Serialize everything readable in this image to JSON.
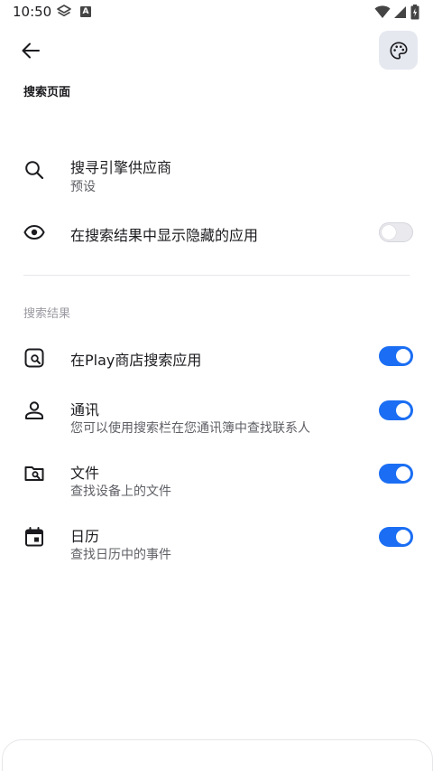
{
  "status_bar": {
    "time": "10:50",
    "notification_badge": "A",
    "icons": [
      "layers-icon",
      "wifi-icon",
      "signal-icon",
      "battery-icon"
    ]
  },
  "header": {
    "title": "搜索页面"
  },
  "settings": {
    "search_engine": {
      "title": "搜寻引擎供应商",
      "subtitle": "预设",
      "icon": "search-icon"
    },
    "show_hidden": {
      "title": "在搜索结果中显示隐藏的应用",
      "icon": "eye-icon",
      "enabled": false
    }
  },
  "results_section": {
    "header": "搜索结果",
    "items": [
      {
        "title": "在Play商店搜索应用",
        "subtitle": "",
        "icon": "store-search-icon",
        "enabled": true
      },
      {
        "title": "通讯",
        "subtitle": "您可以使用搜索栏在您通讯簿中查找联系人",
        "icon": "person-icon",
        "enabled": true
      },
      {
        "title": "文件",
        "subtitle": "查找设备上的文件",
        "icon": "folder-search-icon",
        "enabled": true
      },
      {
        "title": "日历",
        "subtitle": "查找日历中的事件",
        "icon": "calendar-icon",
        "enabled": true
      }
    ]
  },
  "colors": {
    "toggle_on": "#1b6ef3",
    "toggle_off": "#e9e9ee",
    "palette_button_bg": "#e6e8f0"
  }
}
